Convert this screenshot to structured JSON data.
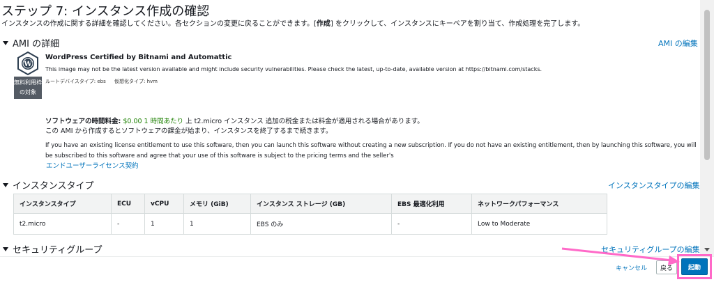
{
  "page": {
    "title": "ステップ 7: インスタンス作成の確認",
    "desc_before": "インスタンスの作成に関する詳細を確認してください。各セクションの変更に戻ることができます。[",
    "desc_bold": "作成",
    "desc_after": "] をクリックして、インスタンスにキーペアを割り当て、作成処理を完了します。"
  },
  "ami": {
    "section_title": "AMI の詳細",
    "edit_link": "AMI の編集",
    "free_badge": "無料利用枠の対象",
    "name": "WordPress Certified by Bitnami and Automattic",
    "warning": "This image may not be the latest version available and might include security vulnerabilities. Please check the latest, up-to-date, available version at https://bitnami.com/stacks.",
    "root_device": "ルートデバイスタイプ: ebs",
    "virtualization": "仮想化タイプ: hvm",
    "price_label": "ソフトウェアの時間料金:",
    "price_value": "$0.00 1 時間あたり",
    "price_rest": "上 t2.micro インスタンス 追加の税金または料金が適用される場合があります。",
    "price_note": "この AMI から作成するとソフトウェアの課金が始まり、インスタンスを終了するまで続きます。",
    "license_text": "If you have an existing license entitlement to use this software, then you can launch this software without creating a new subscription. If you do not have an existing entitlement, then by launching this software, you will be subscribed to this software and agree that your use of this software is subject to the pricing terms and the seller's",
    "license_link": "エンドユーザーライセンス契約"
  },
  "instance_type": {
    "section_title": "インスタンスタイプ",
    "edit_link": "インスタンスタイプの編集",
    "headers": [
      "インスタンスタイプ",
      "ECU",
      "vCPU",
      "メモリ (GiB)",
      "インスタンス ストレージ (GB)",
      "EBS 最適化利用",
      "ネットワークパフォーマンス"
    ],
    "row": [
      "t2.micro",
      "-",
      "1",
      "1",
      "EBS のみ",
      "-",
      "Low to Moderate"
    ]
  },
  "security_group": {
    "section_title": "セキュリティグループ",
    "edit_link": "セキュリティグループの編集"
  },
  "footer": {
    "cancel": "キャンセル",
    "back": "戻る",
    "launch": "起動"
  },
  "colors": {
    "link": "#0073bb",
    "primary": "#0073bb",
    "price_green": "#1d8102",
    "highlight": "#ff69c8"
  }
}
